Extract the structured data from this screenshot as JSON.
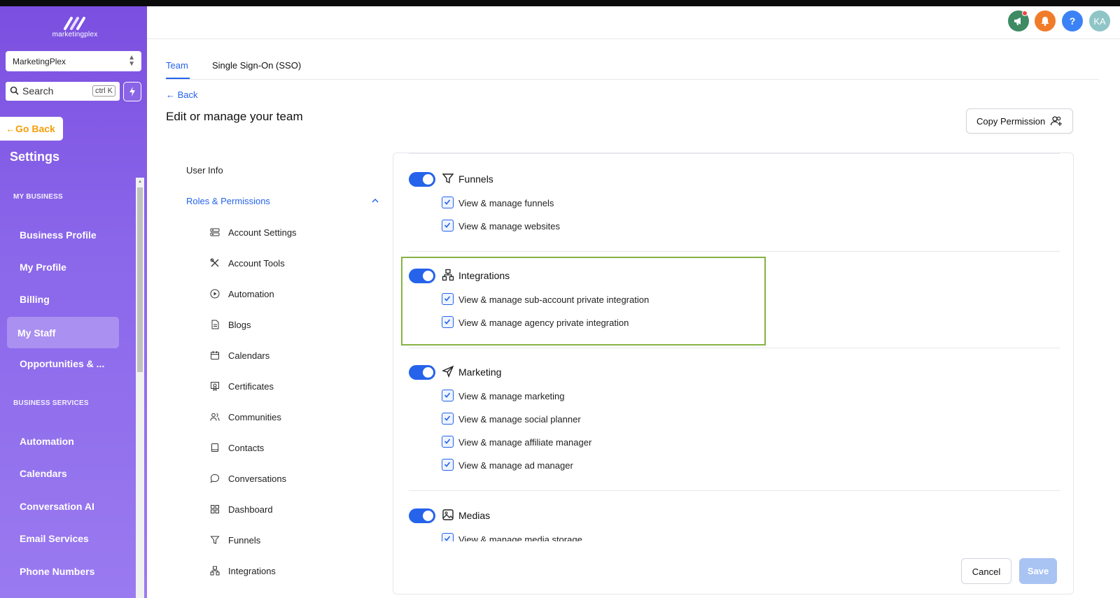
{
  "app": {
    "logo_text": "marketingplex",
    "account_name": "MarketingPlex",
    "search_placeholder": "Search",
    "search_shortcut": "ctrl K",
    "go_back_label": "Go Back",
    "settings_title": "Settings"
  },
  "sidebar": {
    "sections": [
      {
        "label": "MY BUSINESS"
      },
      {
        "label": "BUSINESS SERVICES"
      }
    ],
    "items": [
      {
        "label": "Business Profile"
      },
      {
        "label": "My Profile"
      },
      {
        "label": "Billing"
      },
      {
        "label": "My Staff"
      },
      {
        "label": "Opportunities & ..."
      },
      {
        "label": "Automation"
      },
      {
        "label": "Calendars"
      },
      {
        "label": "Conversation AI"
      },
      {
        "label": "Email Services"
      },
      {
        "label": "Phone Numbers"
      }
    ]
  },
  "header": {
    "avatar_initials": "KA",
    "help_label": "?",
    "colors": {
      "announce": "#3d8a63",
      "bell": "#f07c2a",
      "help": "#3b82f6",
      "avatar": "#8fc5c7"
    }
  },
  "tabs": [
    {
      "label": "Team"
    },
    {
      "label": "Single Sign-On (SSO)"
    }
  ],
  "page": {
    "back_label": "Back",
    "title": "Edit or manage your team",
    "copy_permission_label": "Copy Permission"
  },
  "subnav": {
    "user_info": "User Info",
    "roles_permissions": "Roles & Permissions",
    "items": [
      {
        "label": "Account Settings"
      },
      {
        "label": "Account Tools"
      },
      {
        "label": "Automation"
      },
      {
        "label": "Blogs"
      },
      {
        "label": "Calendars"
      },
      {
        "label": "Certificates"
      },
      {
        "label": "Communities"
      },
      {
        "label": "Contacts"
      },
      {
        "label": "Conversations"
      },
      {
        "label": "Dashboard"
      },
      {
        "label": "Funnels"
      },
      {
        "label": "Integrations"
      }
    ]
  },
  "permissions": {
    "groups": [
      {
        "title": "Funnels",
        "enabled": true,
        "items": [
          "View & manage funnels",
          "View & manage websites"
        ]
      },
      {
        "title": "Integrations",
        "enabled": true,
        "items": [
          "View & manage sub-account private integration",
          "View & manage agency private integration"
        ]
      },
      {
        "title": "Marketing",
        "enabled": true,
        "items": [
          "View & manage marketing",
          "View & manage social planner",
          "View & manage affiliate manager",
          "View & manage ad manager"
        ]
      },
      {
        "title": "Medias",
        "enabled": true,
        "items": [
          "View & manage media storage"
        ]
      }
    ]
  },
  "footer": {
    "cancel_label": "Cancel",
    "save_label": "Save"
  },
  "colors": {
    "accent": "#2563eb",
    "highlight_border": "#86b344",
    "go_back": "#f59e0b"
  }
}
